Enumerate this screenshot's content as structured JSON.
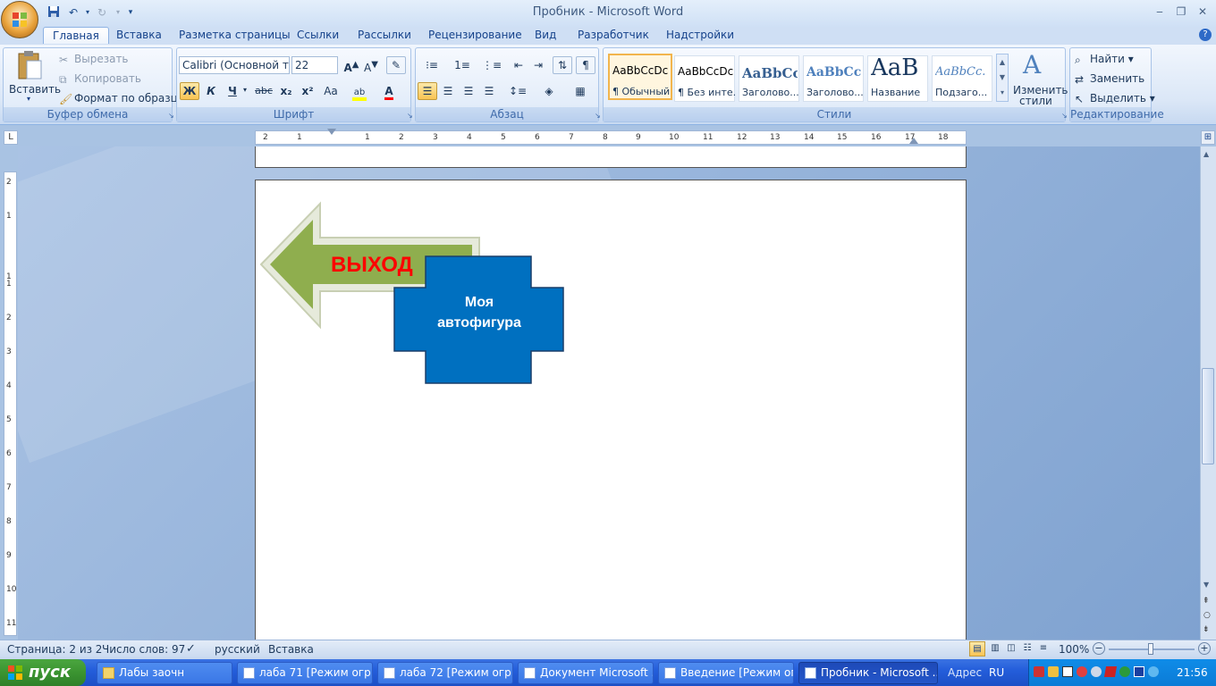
{
  "window": {
    "title": "Пробник - Microsoft Word"
  },
  "quick_access": {
    "save_icon": "save-icon",
    "undo_icon": "undo-icon",
    "redo_icon": "redo-icon",
    "customize_icon": "chevron-down-icon"
  },
  "window_controls": {
    "minimize": "‒",
    "restore": "❐",
    "close": "✕"
  },
  "tabs": [
    "Главная",
    "Вставка",
    "Разметка страницы",
    "Ссылки",
    "Рассылки",
    "Рецензирование",
    "Вид",
    "Разработчик",
    "Надстройки"
  ],
  "clipboard": {
    "paste": "Вставить",
    "cut": "Вырезать",
    "copy": "Копировать",
    "format_painter": "Формат по образцу",
    "label": "Буфер обмена"
  },
  "font": {
    "name": "Calibri (Основной текст)",
    "size": "22",
    "bold": "Ж",
    "italic": "К",
    "underline": "Ч",
    "strike": "abc",
    "subscript": "x₂",
    "superscript": "x²",
    "case": "Aa",
    "label": "Шрифт"
  },
  "paragraph": {
    "label": "Абзац"
  },
  "styles": {
    "items": [
      {
        "sample": "AaBbCcDc",
        "name": "¶ Обычный"
      },
      {
        "sample": "AaBbCcDc",
        "name": "¶ Без инте..."
      },
      {
        "sample": "AaBbCc",
        "name": "Заголово..."
      },
      {
        "sample": "AaBbCc",
        "name": "Заголово..."
      },
      {
        "sample": "AaB",
        "name": "Название"
      },
      {
        "sample": "AaBbCc.",
        "name": "Подзаго..."
      }
    ],
    "change_label_1": "Изменить",
    "change_label_2": "стили",
    "label": "Стили"
  },
  "editing": {
    "find": "Найти",
    "replace": "Заменить",
    "select": "Выделить",
    "label": "Редактирование"
  },
  "ruler": {
    "h": [
      "2",
      "1",
      "1",
      "2",
      "3",
      "4",
      "5",
      "6",
      "7",
      "8",
      "9",
      "10",
      "11",
      "12",
      "13",
      "14",
      "15",
      "16",
      "17",
      "18"
    ],
    "v": [
      "2",
      "1",
      "1",
      "1",
      "2",
      "3",
      "4",
      "5",
      "6",
      "7",
      "8",
      "9",
      "10",
      "11"
    ]
  },
  "document": {
    "arrow_text": "ВЫХОД",
    "shape_text_1": "Моя",
    "shape_text_2": "автофигура",
    "colors": {
      "arrow": "#8fae4e",
      "arrow_text": "#ff0000",
      "shape": "#0070c0"
    }
  },
  "status": {
    "page": "Страница: 2 из 2",
    "words": "Число слов: 97",
    "lang": "русский",
    "mode": "Вставка",
    "zoom": "100%"
  },
  "taskbar": {
    "start": "пуск",
    "tasks": [
      "Лабы заочн",
      "лаба 71 [Режим огр...",
      "лаба 72 [Режим огр...",
      "Документ Microsoft ...",
      "Введение [Режим ог...",
      "Пробник - Microsoft ..."
    ],
    "address": "Адрес",
    "lang": "RU",
    "clock": "21:56"
  }
}
